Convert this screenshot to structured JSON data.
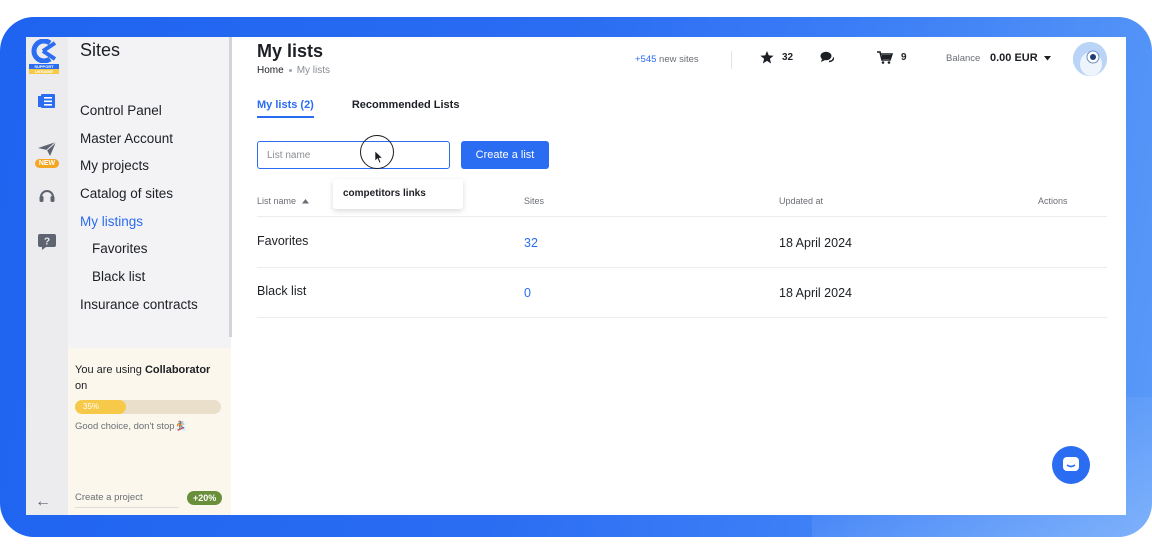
{
  "logo": {
    "badge_text": "SUPPORT UKRAINE"
  },
  "rail": {
    "new_badge": "NEW",
    "icons": [
      "list-icon",
      "paper-plane-icon",
      "headset-icon",
      "question-icon",
      "arrow-left-icon"
    ]
  },
  "sidebar": {
    "title": "Sites",
    "items": [
      {
        "label": "Control Panel",
        "active": false,
        "sub": false
      },
      {
        "label": "Master Account",
        "active": false,
        "sub": false
      },
      {
        "label": "My projects",
        "active": false,
        "sub": false
      },
      {
        "label": "Catalog of sites",
        "active": false,
        "sub": false
      },
      {
        "label": "My listings",
        "active": true,
        "sub": false
      },
      {
        "label": "Favorites",
        "active": false,
        "sub": true
      },
      {
        "label": "Black list",
        "active": false,
        "sub": true
      },
      {
        "label": "Insurance contracts",
        "active": false,
        "sub": false
      }
    ],
    "promo": {
      "text_prefix": "You are using ",
      "text_bold": "Collaborator",
      "text_suffix": " on",
      "progress_label": "35%",
      "progress_value": 35,
      "note": "Good choice, don't stop🏂",
      "bottom_link": "Create a project",
      "bottom_pill": "+20%"
    }
  },
  "header": {
    "title": "My lists",
    "breadcrumb": [
      "Home",
      "My lists"
    ],
    "new_sites_count": "+545",
    "new_sites_label": "new sites",
    "favorites_count": "32",
    "cart_count": "9",
    "balance_label": "Balance",
    "balance_value": "0.00 EUR"
  },
  "tabs": [
    {
      "label": "My lists (2)",
      "active": true
    },
    {
      "label": "Recommended Lists",
      "active": false
    }
  ],
  "form": {
    "input_placeholder": "List name",
    "input_value": "",
    "create_button": "Create a list",
    "suggestion": "competitors links"
  },
  "table": {
    "columns": [
      "List name",
      "Sites",
      "Updated at",
      "Actions"
    ],
    "rows": [
      {
        "name": "Favorites",
        "sites": "32",
        "updated": "18 April 2024"
      },
      {
        "name": "Black list",
        "sites": "0",
        "updated": "18 April 2024"
      }
    ]
  },
  "colors": {
    "accent": "#2a6cf2",
    "promo_bg": "#fbf7ec",
    "progress": "#f7c948",
    "pill": "#6a8f3b"
  }
}
